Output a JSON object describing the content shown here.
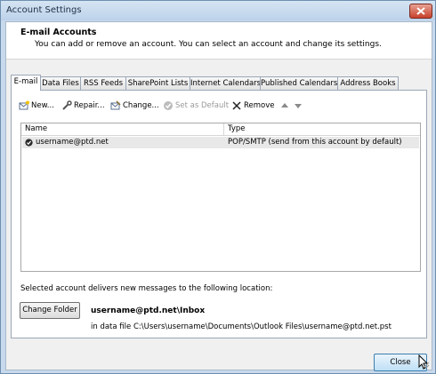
{
  "window": {
    "title": "Account Settings"
  },
  "header": {
    "title": "E-mail Accounts",
    "subtitle": "You can add or remove an account. You can select an account and change its settings."
  },
  "tabs": [
    {
      "label": "E-mail"
    },
    {
      "label": "Data Files"
    },
    {
      "label": "RSS Feeds"
    },
    {
      "label": "SharePoint Lists"
    },
    {
      "label": "Internet Calendars"
    },
    {
      "label": "Published Calendars"
    },
    {
      "label": "Address Books"
    }
  ],
  "toolbar": {
    "new": "New...",
    "repair": "Repair...",
    "change": "Change...",
    "set_default": "Set as Default",
    "remove": "Remove"
  },
  "accounts": {
    "columns": [
      "Name",
      "Type"
    ],
    "rows": [
      {
        "name": "username@ptd.net",
        "type": "POP/SMTP (send from this account by default)"
      }
    ]
  },
  "delivery": {
    "label": "Selected account delivers new messages to the following location:",
    "change_folder": "Change Folder",
    "location": "username@ptd.net\\Inbox",
    "data_file": "in data file C:\\Users\\username\\Documents\\Outlook Files\\username@ptd.net.pst"
  },
  "footer": {
    "close": "Close"
  },
  "colors": {
    "accent": "#3c7fb1",
    "title_close": "#c7402b"
  }
}
